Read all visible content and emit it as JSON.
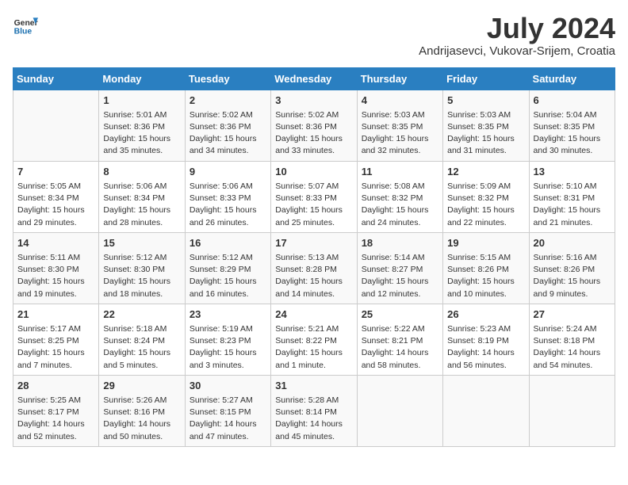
{
  "header": {
    "logo_general": "General",
    "logo_blue": "Blue",
    "month_year": "July 2024",
    "location": "Andrijasevci, Vukovar-Srijem, Croatia"
  },
  "days_of_week": [
    "Sunday",
    "Monday",
    "Tuesday",
    "Wednesday",
    "Thursday",
    "Friday",
    "Saturday"
  ],
  "weeks": [
    [
      {
        "day": "",
        "info": ""
      },
      {
        "day": "1",
        "info": "Sunrise: 5:01 AM\nSunset: 8:36 PM\nDaylight: 15 hours\nand 35 minutes."
      },
      {
        "day": "2",
        "info": "Sunrise: 5:02 AM\nSunset: 8:36 PM\nDaylight: 15 hours\nand 34 minutes."
      },
      {
        "day": "3",
        "info": "Sunrise: 5:02 AM\nSunset: 8:36 PM\nDaylight: 15 hours\nand 33 minutes."
      },
      {
        "day": "4",
        "info": "Sunrise: 5:03 AM\nSunset: 8:35 PM\nDaylight: 15 hours\nand 32 minutes."
      },
      {
        "day": "5",
        "info": "Sunrise: 5:03 AM\nSunset: 8:35 PM\nDaylight: 15 hours\nand 31 minutes."
      },
      {
        "day": "6",
        "info": "Sunrise: 5:04 AM\nSunset: 8:35 PM\nDaylight: 15 hours\nand 30 minutes."
      }
    ],
    [
      {
        "day": "7",
        "info": "Sunrise: 5:05 AM\nSunset: 8:34 PM\nDaylight: 15 hours\nand 29 minutes."
      },
      {
        "day": "8",
        "info": "Sunrise: 5:06 AM\nSunset: 8:34 PM\nDaylight: 15 hours\nand 28 minutes."
      },
      {
        "day": "9",
        "info": "Sunrise: 5:06 AM\nSunset: 8:33 PM\nDaylight: 15 hours\nand 26 minutes."
      },
      {
        "day": "10",
        "info": "Sunrise: 5:07 AM\nSunset: 8:33 PM\nDaylight: 15 hours\nand 25 minutes."
      },
      {
        "day": "11",
        "info": "Sunrise: 5:08 AM\nSunset: 8:32 PM\nDaylight: 15 hours\nand 24 minutes."
      },
      {
        "day": "12",
        "info": "Sunrise: 5:09 AM\nSunset: 8:32 PM\nDaylight: 15 hours\nand 22 minutes."
      },
      {
        "day": "13",
        "info": "Sunrise: 5:10 AM\nSunset: 8:31 PM\nDaylight: 15 hours\nand 21 minutes."
      }
    ],
    [
      {
        "day": "14",
        "info": "Sunrise: 5:11 AM\nSunset: 8:30 PM\nDaylight: 15 hours\nand 19 minutes."
      },
      {
        "day": "15",
        "info": "Sunrise: 5:12 AM\nSunset: 8:30 PM\nDaylight: 15 hours\nand 18 minutes."
      },
      {
        "day": "16",
        "info": "Sunrise: 5:12 AM\nSunset: 8:29 PM\nDaylight: 15 hours\nand 16 minutes."
      },
      {
        "day": "17",
        "info": "Sunrise: 5:13 AM\nSunset: 8:28 PM\nDaylight: 15 hours\nand 14 minutes."
      },
      {
        "day": "18",
        "info": "Sunrise: 5:14 AM\nSunset: 8:27 PM\nDaylight: 15 hours\nand 12 minutes."
      },
      {
        "day": "19",
        "info": "Sunrise: 5:15 AM\nSunset: 8:26 PM\nDaylight: 15 hours\nand 10 minutes."
      },
      {
        "day": "20",
        "info": "Sunrise: 5:16 AM\nSunset: 8:26 PM\nDaylight: 15 hours\nand 9 minutes."
      }
    ],
    [
      {
        "day": "21",
        "info": "Sunrise: 5:17 AM\nSunset: 8:25 PM\nDaylight: 15 hours\nand 7 minutes."
      },
      {
        "day": "22",
        "info": "Sunrise: 5:18 AM\nSunset: 8:24 PM\nDaylight: 15 hours\nand 5 minutes."
      },
      {
        "day": "23",
        "info": "Sunrise: 5:19 AM\nSunset: 8:23 PM\nDaylight: 15 hours\nand 3 minutes."
      },
      {
        "day": "24",
        "info": "Sunrise: 5:21 AM\nSunset: 8:22 PM\nDaylight: 15 hours\nand 1 minute."
      },
      {
        "day": "25",
        "info": "Sunrise: 5:22 AM\nSunset: 8:21 PM\nDaylight: 14 hours\nand 58 minutes."
      },
      {
        "day": "26",
        "info": "Sunrise: 5:23 AM\nSunset: 8:19 PM\nDaylight: 14 hours\nand 56 minutes."
      },
      {
        "day": "27",
        "info": "Sunrise: 5:24 AM\nSunset: 8:18 PM\nDaylight: 14 hours\nand 54 minutes."
      }
    ],
    [
      {
        "day": "28",
        "info": "Sunrise: 5:25 AM\nSunset: 8:17 PM\nDaylight: 14 hours\nand 52 minutes."
      },
      {
        "day": "29",
        "info": "Sunrise: 5:26 AM\nSunset: 8:16 PM\nDaylight: 14 hours\nand 50 minutes."
      },
      {
        "day": "30",
        "info": "Sunrise: 5:27 AM\nSunset: 8:15 PM\nDaylight: 14 hours\nand 47 minutes."
      },
      {
        "day": "31",
        "info": "Sunrise: 5:28 AM\nSunset: 8:14 PM\nDaylight: 14 hours\nand 45 minutes."
      },
      {
        "day": "",
        "info": ""
      },
      {
        "day": "",
        "info": ""
      },
      {
        "day": "",
        "info": ""
      }
    ]
  ]
}
